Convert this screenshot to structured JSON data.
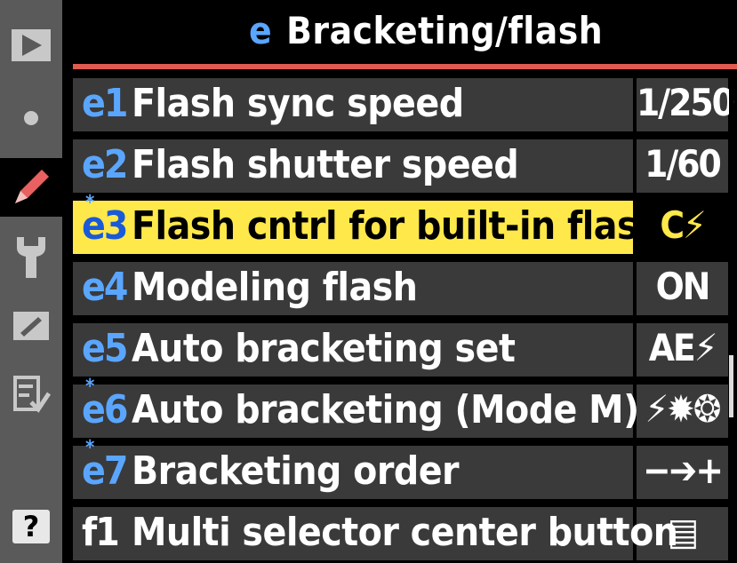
{
  "sidebar": {
    "tabs": [
      {
        "name": "playback-menu-tab",
        "icon": "play-icon"
      },
      {
        "name": "shooting-menu-tab",
        "icon": "camera-icon"
      },
      {
        "name": "custom-settings-tab",
        "icon": "pencil-icon",
        "active": true
      },
      {
        "name": "setup-menu-tab",
        "icon": "wrench-icon"
      },
      {
        "name": "retouch-menu-tab",
        "icon": "retouch-icon"
      },
      {
        "name": "my-menu-tab",
        "icon": "my-menu-icon"
      }
    ],
    "help_label": "?"
  },
  "header": {
    "code": "e",
    "title": "Bracketing/flash"
  },
  "menu": {
    "items": [
      {
        "code": "e1",
        "label": "Flash sync speed",
        "value": "1/250"
      },
      {
        "code": "e2",
        "label": "Flash shutter speed",
        "value": "1/60"
      },
      {
        "code": "e3",
        "label": "Flash cntrl for built-in flash",
        "value": "C⚡",
        "modified": true,
        "selected": true
      },
      {
        "code": "e4",
        "label": "Modeling flash",
        "value": "ON"
      },
      {
        "code": "e5",
        "label": "Auto bracketing set",
        "value": "AE⚡"
      },
      {
        "code": "e6",
        "label": "Auto bracketing (Mode M)",
        "value": "⚡✹❂",
        "modified": true
      },
      {
        "code": "e7",
        "label": "Bracketing order",
        "value": "−➔+",
        "modified": true
      },
      {
        "code": "f1",
        "label": "Multi selector center button",
        "value": "▤"
      }
    ]
  },
  "colors": {
    "accent_blue": "#5aa6ff",
    "highlight": "#ffe84a",
    "rule": "#e05a4e",
    "row_bg": "#3a3a3a"
  }
}
